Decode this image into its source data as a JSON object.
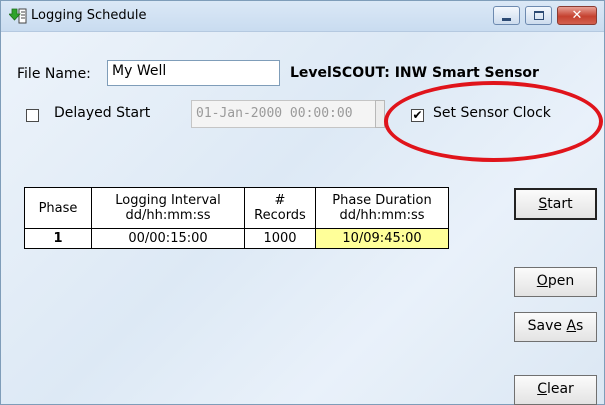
{
  "window": {
    "title": "Logging Schedule",
    "minimize_label": "minimize",
    "maximize_label": "maximize",
    "close_label": "close"
  },
  "file": {
    "label": "File Name:",
    "value": "My Well"
  },
  "sensor": {
    "name": "LevelSCOUT: INW Smart Sensor"
  },
  "delayed_start": {
    "label": "Delayed Start",
    "checked": false,
    "datetime_value": "01-Jan-2000  00:00:00"
  },
  "set_clock": {
    "label": "Set Sensor Clock",
    "checked": true,
    "check_mark": "✔"
  },
  "schedule_table": {
    "headers": [
      {
        "line1": "Phase",
        "line2": ""
      },
      {
        "line1": "Logging Interval",
        "line2": "dd/hh:mm:ss"
      },
      {
        "line1": "#",
        "line2": "Records"
      },
      {
        "line1": "Phase Duration",
        "line2": "dd/hh:mm:ss"
      }
    ],
    "rows": [
      {
        "phase": "1",
        "interval": "00/00:15:00",
        "records": "1000",
        "duration": "10/09:45:00"
      }
    ]
  },
  "buttons": {
    "start": {
      "mnemonic": "S",
      "rest": "tart"
    },
    "open": {
      "mnemonic": "O",
      "rest": "pen"
    },
    "save_as": {
      "prefix": "Save ",
      "mnemonic": "A",
      "rest": "s"
    },
    "clear": {
      "mnemonic": "C",
      "rest": "lear"
    }
  },
  "colors": {
    "highlight_circle": "#e0141b",
    "duration_cell_bg": "#ffff99",
    "close_button": "#c5412f"
  }
}
